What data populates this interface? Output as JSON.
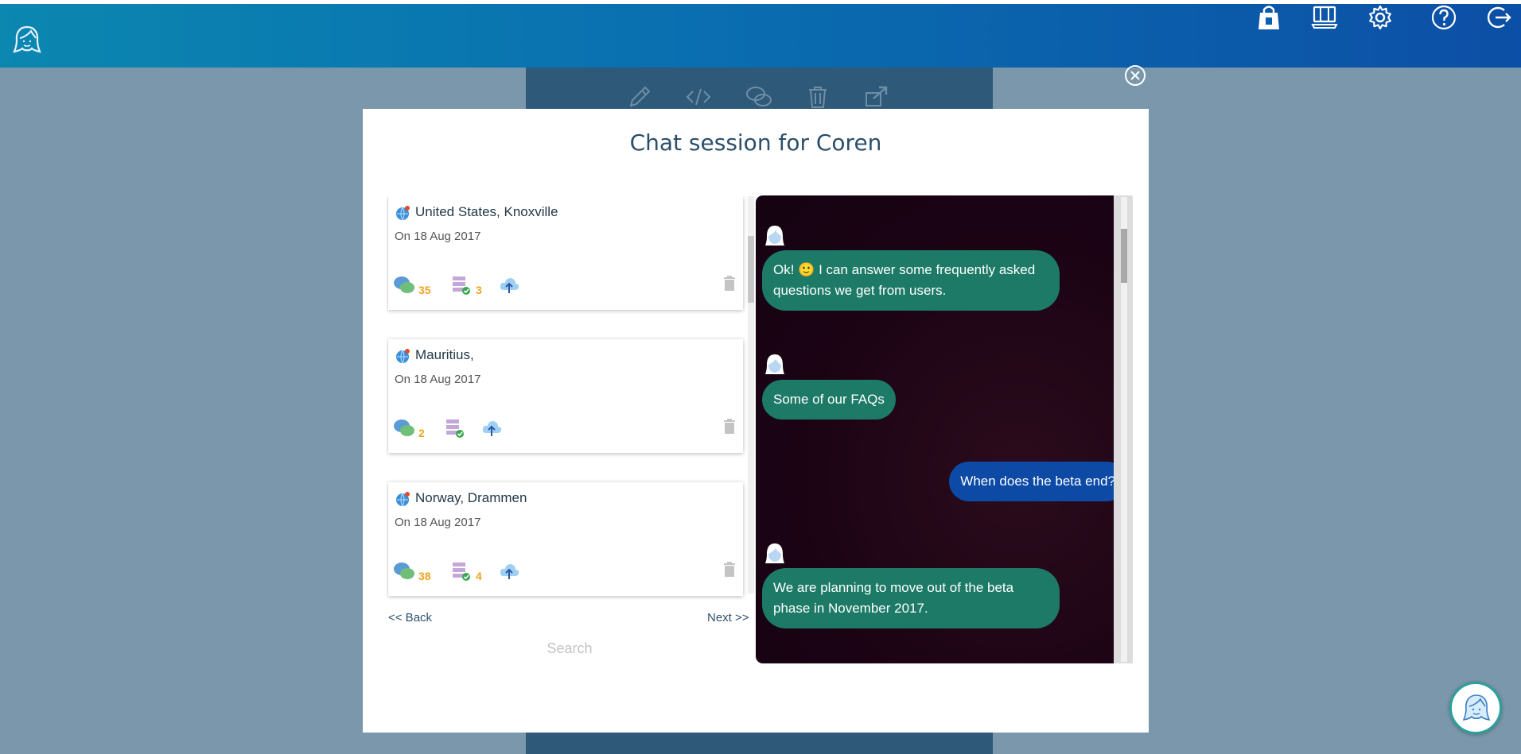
{
  "header": {
    "icons": [
      "brand-face-icon",
      "shopping-bag-icon",
      "monitor-icon",
      "gear-icon",
      "help-icon",
      "logout-icon"
    ]
  },
  "background_toolbar": {
    "icons": [
      "pencil-icon",
      "code-icon",
      "chat-bubbles-icon",
      "trash-icon",
      "share-icon"
    ]
  },
  "modal": {
    "title": "Chat session for Coren",
    "sessions": [
      {
        "location": "United States, Knoxville",
        "date": "On 18 Aug 2017",
        "messages": "35",
        "intents": "3"
      },
      {
        "location": "Mauritius,",
        "date": "On 18 Aug 2017",
        "messages": "2",
        "intents": ""
      },
      {
        "location": "Norway, Drammen",
        "date": "On 18 Aug 2017",
        "messages": "38",
        "intents": "4"
      }
    ],
    "pager": {
      "back": "<< Back",
      "next": "Next >>"
    },
    "search": {
      "placeholder": "Search",
      "value": ""
    }
  },
  "chat": {
    "messages": [
      {
        "from": "bot",
        "text_before": "Ok! ",
        "emoji": "🙂",
        "text_after": " I can answer some frequently asked questions we get from users."
      },
      {
        "from": "bot",
        "text": "Some of our FAQs"
      },
      {
        "from": "user",
        "text": "When does the beta end?"
      },
      {
        "from": "bot",
        "text": "We are planning to move out of the beta phase in November 2017."
      }
    ]
  },
  "colors": {
    "header_start": "#0b87b0",
    "header_end": "#0c4fa6",
    "bot_bubble": "#1d7a67",
    "user_bubble": "#0c4aa6",
    "count_accent": "#f0a21c",
    "chat_background": "#1b0314"
  }
}
